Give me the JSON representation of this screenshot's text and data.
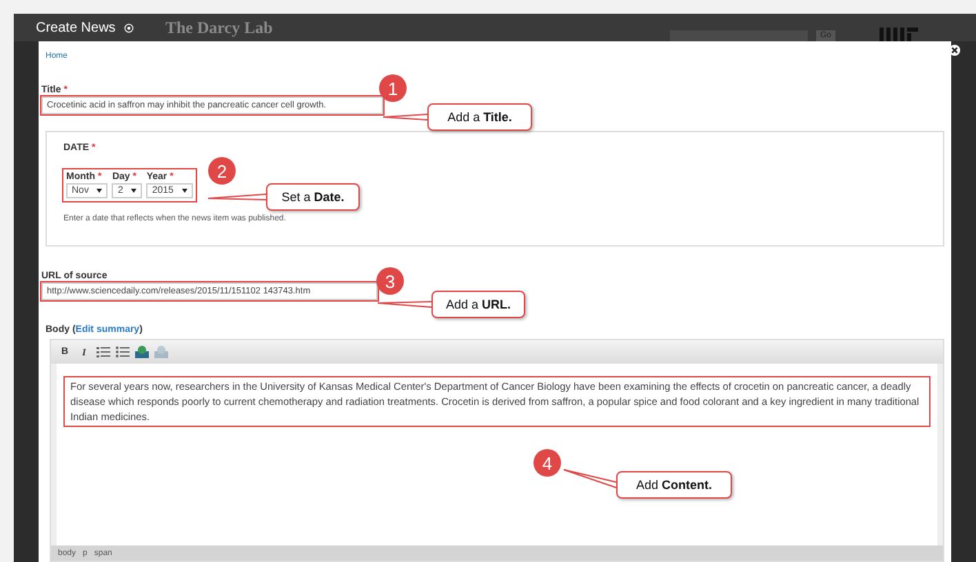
{
  "window": {
    "title": "Create News"
  },
  "backdrop": {
    "site_title": "The Darcy Lab",
    "go_button": "Go"
  },
  "breadcrumb": "Home",
  "title_field": {
    "label": "Title",
    "required_mark": "*",
    "value": "Crocetinic acid in saffron may inhibit the pancreatic  cancer cell growth."
  },
  "date": {
    "legend": "DATE",
    "required_mark": "*",
    "selects": [
      {
        "label": "Month",
        "required_mark": "*",
        "value": "Nov"
      },
      {
        "label": "Day",
        "required_mark": "*",
        "value": "2"
      },
      {
        "label": "Year",
        "required_mark": "*",
        "value": "2015"
      }
    ],
    "description": "Enter a date that reflects when the news item was published."
  },
  "url_field": {
    "label": "URL of source",
    "value": "http://www.sciencedaily.com/releases/2015/11/151102  143743.htm"
  },
  "body": {
    "label_prefix": "Body (",
    "link": "Edit summary",
    "label_suffix": ")",
    "toolbar": [
      {
        "kind": "bold",
        "label": "B"
      },
      {
        "kind": "italic",
        "label": "I"
      },
      {
        "kind": "ordered-list"
      },
      {
        "kind": "bullet-list"
      },
      {
        "kind": "image"
      },
      {
        "kind": "image-disabled"
      }
    ],
    "text": "For several years now, researchers in the University of Kansas Medical Center's Department of Cancer Biology have been examining the effects of crocetin on pancreatic cancer, a deadly disease which responds poorly to current chemotherapy and radiation treatments. Crocetin is derived from saffron, a popular spice and food colorant and a key ingredient in many traditional Indian medicines.",
    "path": [
      "body",
      "p",
      "span"
    ]
  },
  "annotations": [
    {
      "number": "1",
      "text": "Add a **Title.**"
    },
    {
      "number": "2",
      "text": "Set a **Date.**"
    },
    {
      "number": "3",
      "text": "Add a **URL.**"
    },
    {
      "number": "4",
      "text": "Add **Content.**"
    }
  ]
}
